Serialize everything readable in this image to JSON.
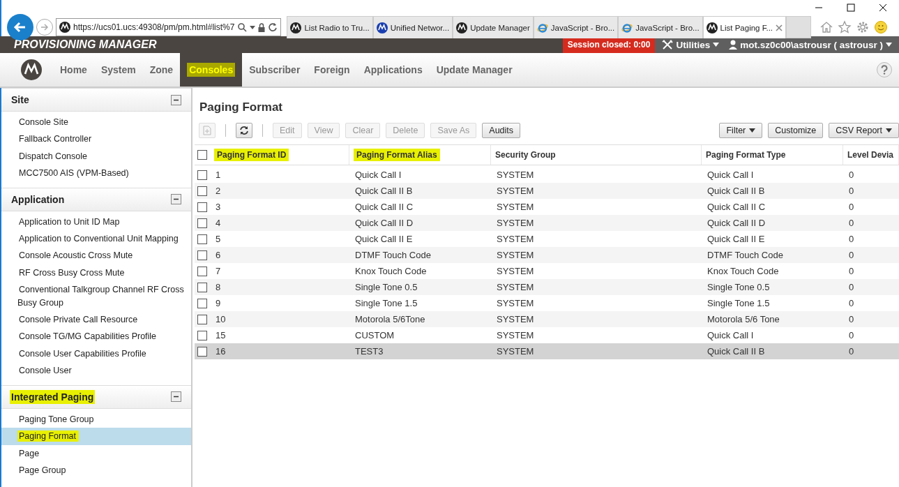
{
  "browser": {
    "url": "https://ucs01.ucs:49308/pm/pm.html#list%7",
    "tabs": [
      {
        "label": "List Radio to Tru...",
        "kind": "motorola",
        "selected": false
      },
      {
        "label": "Unified Networ...",
        "kind": "network",
        "selected": false
      },
      {
        "label": "Update Manager",
        "kind": "motorola",
        "selected": false
      },
      {
        "label": "JavaScript - Bro...",
        "kind": "ie",
        "selected": false
      },
      {
        "label": "JavaScript - Bro...",
        "kind": "ie",
        "selected": false
      },
      {
        "label": "List Paging F...",
        "kind": "motorola",
        "selected": true
      }
    ]
  },
  "app_bar": {
    "title": "PROVISIONING MANAGER",
    "session": "Session closed: 0:00",
    "utilities": "Utilities",
    "user": "mot.sz0c00\\astrousr ( astrousr )"
  },
  "nav": [
    {
      "label": "Home",
      "selected": false,
      "highlighted": false
    },
    {
      "label": "System",
      "selected": false,
      "highlighted": false
    },
    {
      "label": "Zone",
      "selected": false,
      "highlighted": false
    },
    {
      "label": "Consoles",
      "selected": true,
      "highlighted": true
    },
    {
      "label": "Subscriber",
      "selected": false,
      "highlighted": false
    },
    {
      "label": "Foreign",
      "selected": false,
      "highlighted": false
    },
    {
      "label": "Applications",
      "selected": false,
      "highlighted": false
    },
    {
      "label": "Update Manager",
      "selected": false,
      "highlighted": false
    }
  ],
  "sidebar": [
    {
      "title": "Site",
      "highlighted": false,
      "expanded": true,
      "items": [
        {
          "label": "Console Site",
          "selected": false,
          "highlighted": false
        },
        {
          "label": "Fallback Controller",
          "selected": false,
          "highlighted": false
        },
        {
          "label": "Dispatch Console",
          "selected": false,
          "highlighted": false
        },
        {
          "label": "MCC7500 AIS (VPM-Based)",
          "selected": false,
          "highlighted": false
        }
      ]
    },
    {
      "title": "Application",
      "highlighted": false,
      "expanded": true,
      "items": [
        {
          "label": "Application to Unit ID Map",
          "selected": false,
          "highlighted": false
        },
        {
          "label": "Application to Conventional Unit Mapping",
          "selected": false,
          "highlighted": false
        },
        {
          "label": "Console Acoustic Cross Mute",
          "selected": false,
          "highlighted": false
        },
        {
          "label": "RF Cross Busy Cross Mute",
          "selected": false,
          "highlighted": false
        },
        {
          "label": "Conventional Talkgroup Channel RF Cross Busy Group",
          "selected": false,
          "highlighted": false
        },
        {
          "label": "Console Private Call Resource",
          "selected": false,
          "highlighted": false
        },
        {
          "label": "Console TG/MG Capabilities Profile",
          "selected": false,
          "highlighted": false
        },
        {
          "label": "Console User Capabilities Profile",
          "selected": false,
          "highlighted": false
        },
        {
          "label": "Console User",
          "selected": false,
          "highlighted": false
        }
      ]
    },
    {
      "title": "Integrated Paging",
      "highlighted": true,
      "expanded": true,
      "items": [
        {
          "label": "Paging Tone Group",
          "selected": false,
          "highlighted": false
        },
        {
          "label": "Paging Format",
          "selected": true,
          "highlighted": true
        },
        {
          "label": "Page",
          "selected": false,
          "highlighted": false
        },
        {
          "label": "Page Group",
          "selected": false,
          "highlighted": false
        }
      ]
    }
  ],
  "page_title": "Paging Format",
  "toolbar": [
    {
      "label": "Edit",
      "disabled": true
    },
    {
      "label": "View",
      "disabled": true
    },
    {
      "label": "Clear",
      "disabled": true
    },
    {
      "label": "Delete",
      "disabled": true
    },
    {
      "label": "Save As",
      "disabled": true
    },
    {
      "label": "Audits",
      "disabled": false
    }
  ],
  "toolbar_right": [
    {
      "label": "Filter",
      "dropdown": true
    },
    {
      "label": "Customize",
      "dropdown": false
    },
    {
      "label": "CSV Report",
      "dropdown": true
    }
  ],
  "table": {
    "all_checked": false,
    "columns": [
      {
        "label": "Paging Format ID",
        "highlighted": true
      },
      {
        "label": "Paging Format Alias",
        "highlighted": true
      },
      {
        "label": "Security Group",
        "highlighted": false
      },
      {
        "label": "Paging Format Type",
        "highlighted": false
      },
      {
        "label": "Level Devia",
        "highlighted": false
      }
    ],
    "rows": [
      {
        "cells": [
          "1",
          "Quick Call I",
          "SYSTEM",
          "Quick Call I",
          "0"
        ],
        "selected": false,
        "checked": false
      },
      {
        "cells": [
          "2",
          "Quick Call II B",
          "SYSTEM",
          "Quick Call II B",
          "0"
        ],
        "selected": false,
        "checked": false
      },
      {
        "cells": [
          "3",
          "Quick Call II C",
          "SYSTEM",
          "Quick Call II C",
          "0"
        ],
        "selected": false,
        "checked": false
      },
      {
        "cells": [
          "4",
          "Quick Call II D",
          "SYSTEM",
          "Quick Call II D",
          "0"
        ],
        "selected": false,
        "checked": false
      },
      {
        "cells": [
          "5",
          "Quick Call II E",
          "SYSTEM",
          "Quick Call II E",
          "0"
        ],
        "selected": false,
        "checked": false
      },
      {
        "cells": [
          "6",
          "DTMF Touch Code",
          "SYSTEM",
          "DTMF Touch Code",
          "0"
        ],
        "selected": false,
        "checked": false
      },
      {
        "cells": [
          "7",
          "Knox Touch Code",
          "SYSTEM",
          "Knox Touch Code",
          "0"
        ],
        "selected": false,
        "checked": false
      },
      {
        "cells": [
          "8",
          "Single Tone 0.5",
          "SYSTEM",
          "Single Tone 0.5",
          "0"
        ],
        "selected": false,
        "checked": false
      },
      {
        "cells": [
          "9",
          "Single Tone 1.5",
          "SYSTEM",
          "Single Tone 1.5",
          "0"
        ],
        "selected": false,
        "checked": false
      },
      {
        "cells": [
          "10",
          "Motorola 5/6Tone",
          "SYSTEM",
          "Motorola 5/6 Tone",
          "0"
        ],
        "selected": false,
        "checked": false
      },
      {
        "cells": [
          "15",
          "CUSTOM",
          "SYSTEM",
          "Quick Call I",
          "0"
        ],
        "selected": false,
        "checked": false
      },
      {
        "cells": [
          "16",
          "TEST3",
          "SYSTEM",
          "Quick Call II B",
          "0"
        ],
        "selected": true,
        "checked": false
      }
    ]
  }
}
